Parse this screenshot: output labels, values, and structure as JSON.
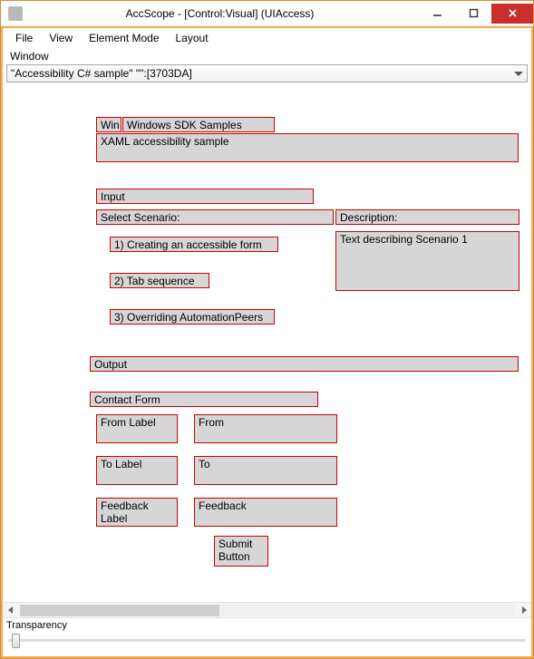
{
  "window": {
    "title": "AccScope - [Control:Visual] (UIAccess)"
  },
  "menubar": {
    "file": "File",
    "view": "View",
    "element_mode": "Element Mode",
    "layout": "Layout"
  },
  "selector": {
    "label": "Window",
    "value": "\"Accessibility C# sample\" \"\":[3703DA]"
  },
  "nodes": {
    "win": "Win",
    "win_sdk_samples": "Windows SDK Samples",
    "xaml_sample": "XAML accessibility sample",
    "input": "Input",
    "select_scenario": "Select Scenario:",
    "description": "Description:",
    "scenario1": "1) Creating an accessible form",
    "scenario2": "2) Tab sequence",
    "scenario3": "3) Overriding AutomationPeers",
    "desc_text": "Text describing Scenario 1",
    "output": "Output",
    "contact_form": "Contact Form",
    "from_label": "From Label",
    "from": "From",
    "to_label": "To Label",
    "to": "To",
    "feedback_label": "Feedback Label",
    "feedback": "Feedback",
    "submit": "Submit Button"
  },
  "footer": {
    "transparency": "Transparency"
  }
}
